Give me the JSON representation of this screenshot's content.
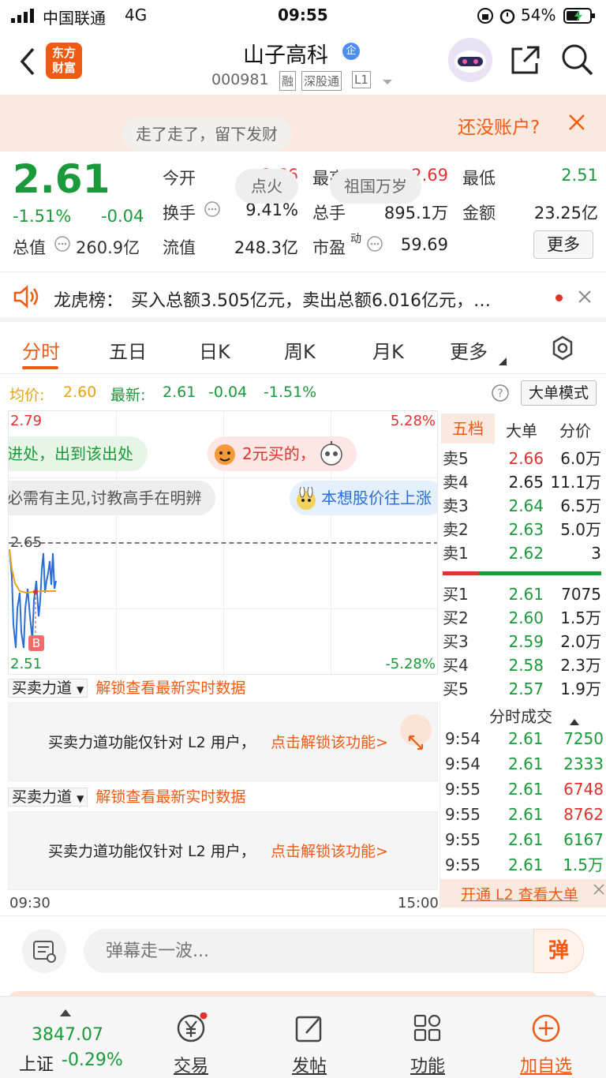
{
  "status_bar": {
    "carrier": "中国联通",
    "network": "4G",
    "time": "09:55",
    "battery": "54%"
  },
  "header": {
    "stock_name": "山子高科",
    "badge": "企",
    "code": "000981",
    "tags": [
      "融",
      "深股通",
      "L1"
    ],
    "logo_line1": "东方",
    "logo_line2": "财富"
  },
  "notice": {
    "text": "还没账户?"
  },
  "quote": {
    "price": "2.61",
    "change_pct": "-1.51%",
    "change": "-0.04",
    "open_label": "今开",
    "open": "2.66",
    "high_label": "最高",
    "high": "2.69",
    "low_label": "最低",
    "low": "2.51",
    "turnover_label": "换手",
    "turnover": "9.41%",
    "volume_label": "总手",
    "volume": "895.1万",
    "amount_label": "金额",
    "amount": "23.25亿",
    "mktcap_label": "总值",
    "mktcap": "260.9亿",
    "float_label": "流值",
    "float_cap": "248.3亿",
    "pe_label": "市盈",
    "pe_sup": "动",
    "pe": "59.69",
    "more_button": "更多"
  },
  "longhu": {
    "label": "龙虎榜：",
    "text": "买入总额3.505亿元，卖出总额6.016亿元，…"
  },
  "tabs": [
    "分时",
    "五日",
    "日K",
    "周K",
    "月K",
    "更多"
  ],
  "chart_info": {
    "avg_label": "均价:",
    "avg": "2.60",
    "latest_label": "最新:",
    "latest": "2.61",
    "chg": "-0.04",
    "pct": "-1.51%",
    "mode_button": "大单模式"
  },
  "chart_labels": {
    "top_price": "2.79",
    "top_pct": "5.28%",
    "mid_price": "2.65",
    "bottom_price": "2.51",
    "bottom_pct": "-5.28%",
    "marker": "B",
    "time_start": "09:30",
    "time_end": "15:00"
  },
  "danmu": [
    "进处，出到该出处",
    "2元买的，",
    "必需有主见,讨教高手在明辨",
    "本想股价往上涨",
    "走了走了，留下发财",
    "点火",
    "祖国万岁"
  ],
  "book": {
    "tabs": [
      "五档",
      "大单",
      "分价"
    ],
    "asks": [
      {
        "label": "卖5",
        "price": "2.66",
        "vol": "6.0万"
      },
      {
        "label": "卖4",
        "price": "2.65",
        "vol": "11.1万"
      },
      {
        "label": "卖3",
        "price": "2.64",
        "vol": "6.5万"
      },
      {
        "label": "卖2",
        "price": "2.63",
        "vol": "5.0万"
      },
      {
        "label": "卖1",
        "price": "2.62",
        "vol": "3"
      }
    ],
    "bids": [
      {
        "label": "买1",
        "price": "2.61",
        "vol": "7075"
      },
      {
        "label": "买2",
        "price": "2.60",
        "vol": "1.5万"
      },
      {
        "label": "买3",
        "price": "2.59",
        "vol": "2.0万"
      },
      {
        "label": "买4",
        "price": "2.58",
        "vol": "2.3万"
      },
      {
        "label": "买5",
        "price": "2.57",
        "vol": "1.9万"
      }
    ]
  },
  "trades": {
    "title": "分时成交",
    "rows": [
      {
        "time": "9:54",
        "price": "2.61",
        "vol": "7250",
        "dir": "buy"
      },
      {
        "time": "9:54",
        "price": "2.61",
        "vol": "2333",
        "dir": "buy"
      },
      {
        "time": "9:55",
        "price": "2.61",
        "vol": "6748",
        "dir": "sell"
      },
      {
        "time": "9:55",
        "price": "2.61",
        "vol": "8762",
        "dir": "sell"
      },
      {
        "time": "9:55",
        "price": "2.61",
        "vol": "6167",
        "dir": "buy"
      },
      {
        "time": "9:55",
        "price": "2.61",
        "vol": "1.5万",
        "dir": "buy"
      }
    ],
    "upgrade_link": "开通 L2 查看大单"
  },
  "indicators": {
    "name": "买卖力道",
    "unlock": "解锁查看最新实时数据",
    "locked_text": "买卖力道功能仅针对 L2 用户，",
    "locked_link": "点击解锁该功能>"
  },
  "comment": {
    "placeholder": "弹幕走一波...",
    "send": "弹"
  },
  "bottom_nav": {
    "index_value": "3847.07",
    "index_name": "上证",
    "index_chg": "-0.29%",
    "items": [
      "交易",
      "发帖",
      "功能",
      "加自选"
    ]
  },
  "colors": {
    "up": "#e0322f",
    "down": "#1a9a3a",
    "accent": "#f05a14"
  }
}
